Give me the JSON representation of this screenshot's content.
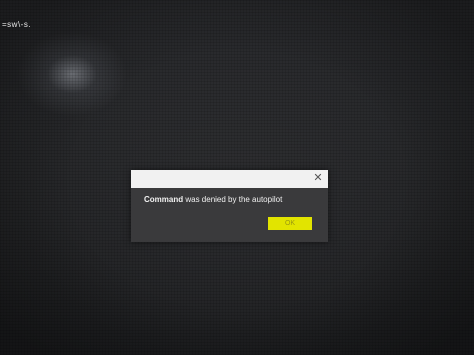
{
  "corner": {
    "label": "=sw\\-s."
  },
  "dialog": {
    "message_bold": "Command",
    "message_rest": " was denied by the autopilot",
    "close_glyph": "✕",
    "ok_label": "OK",
    "ok_color": "#e2e400"
  }
}
